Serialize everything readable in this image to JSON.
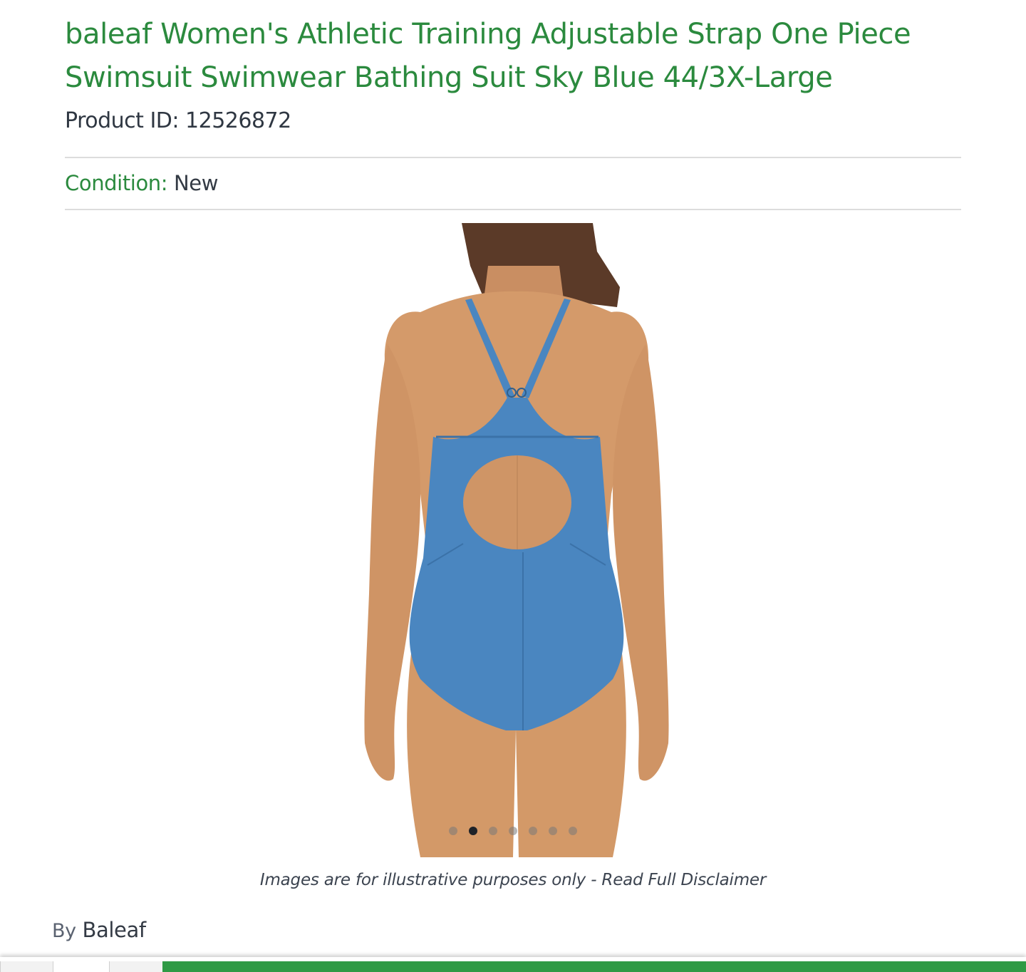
{
  "product": {
    "title": "baleaf Women's Athletic Training Adjustable Strap One Piece Swimsuit Swimwear Bathing Suit Sky Blue 44/3X-Large",
    "id_text": "Product ID: 12526872",
    "condition_label": "Condition:",
    "condition_value": "New"
  },
  "gallery": {
    "image_alt": "Back view of sky blue one piece swimsuit with keyhole cutout",
    "dot_count": 7,
    "active_index": 1
  },
  "disclaimer": {
    "text": "Images are for illustrative purposes only - ",
    "link": "Read Full Disclaimer"
  },
  "brand": {
    "by": "By",
    "name": "Baleaf"
  },
  "colors": {
    "accent_green": "#2b8a3e",
    "cart_green": "#2f9a45",
    "swimsuit_blue": "#4a86c0"
  }
}
